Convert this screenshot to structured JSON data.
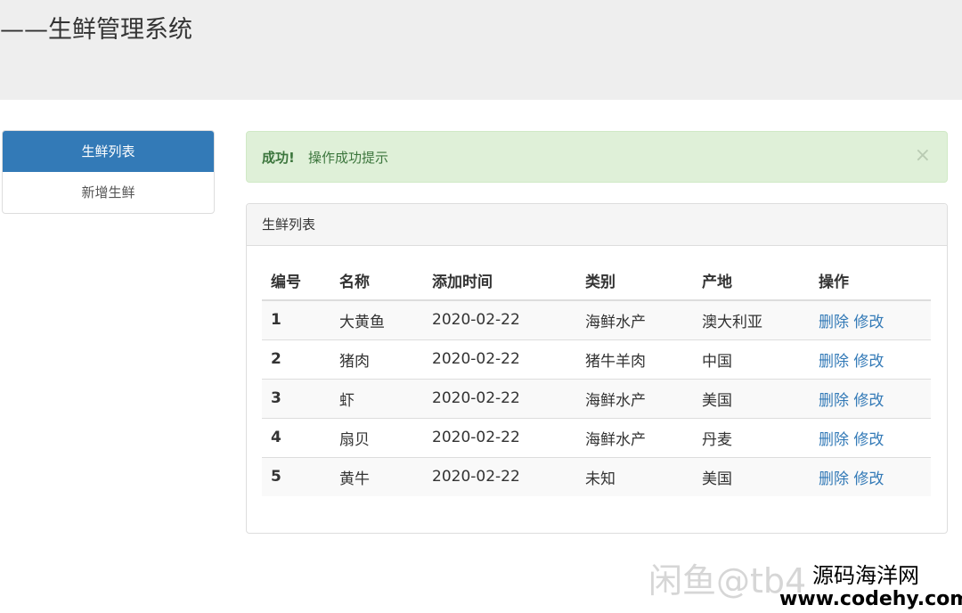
{
  "header": {
    "title": "——生鲜管理系统"
  },
  "sidebar": {
    "items": [
      {
        "label": "生鲜列表",
        "active": true
      },
      {
        "label": "新增生鲜",
        "active": false
      }
    ]
  },
  "alert": {
    "strong": "成功!",
    "message": "操作成功提示",
    "close": "×"
  },
  "panel": {
    "title": "生鲜列表",
    "table": {
      "headers": [
        "编号",
        "名称",
        "添加时间",
        "类别",
        "产地",
        "操作"
      ],
      "rows": [
        {
          "id": "1",
          "name": "大黄鱼",
          "date": "2020-02-22",
          "category": "海鲜水产",
          "origin": "澳大利亚"
        },
        {
          "id": "2",
          "name": "猪肉",
          "date": "2020-02-22",
          "category": "猪牛羊肉",
          "origin": "中国"
        },
        {
          "id": "3",
          "name": "虾",
          "date": "2020-02-22",
          "category": "海鲜水产",
          "origin": "美国"
        },
        {
          "id": "4",
          "name": "扇贝",
          "date": "2020-02-22",
          "category": "海鲜水产",
          "origin": "丹麦"
        },
        {
          "id": "5",
          "name": "黄牛",
          "date": "2020-02-22",
          "category": "未知",
          "origin": "美国"
        }
      ],
      "actions": {
        "delete": "删除",
        "edit": "修改"
      }
    }
  },
  "watermark": {
    "text": "闲鱼@tb4",
    "site_name": "源码海洋网",
    "site_url": "www.codehy.com"
  },
  "colors": {
    "primary": "#337ab7",
    "success_bg": "#dff0d8",
    "success_text": "#3c763d",
    "header_bg": "#eeeeee"
  }
}
